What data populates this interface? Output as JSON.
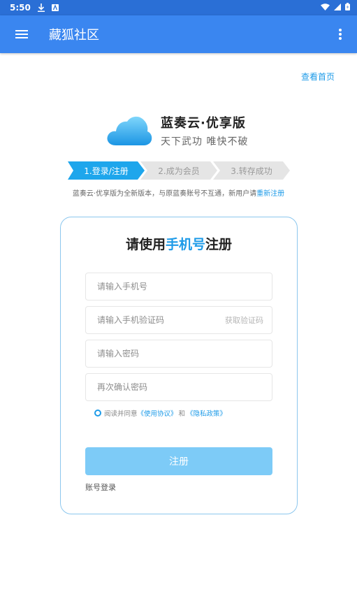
{
  "status_bar": {
    "time": "5:50"
  },
  "app_bar": {
    "title": "藏狐社区"
  },
  "header_link": "查看首页",
  "brand": {
    "name": "蓝奏云·优享版",
    "slogan": "天下武功 唯快不破"
  },
  "steps": [
    {
      "label": "1.登录/注册",
      "active": true
    },
    {
      "label": "2.成为会员",
      "active": false
    },
    {
      "label": "3.转存成功",
      "active": false
    }
  ],
  "notice": {
    "text": "蓝奏云·优享版为全新版本，与原蓝奏账号不互通，新用户请",
    "link": "重新注册"
  },
  "form": {
    "title_prefix": "请使用",
    "title_highlight": "手机号",
    "title_suffix": "注册",
    "phone_placeholder": "请输入手机号",
    "code_placeholder": "请输入手机验证码",
    "get_code": "获取验证码",
    "password_placeholder": "请输入密码",
    "confirm_placeholder": "再次确认密码",
    "agree_prefix": "阅读并同意",
    "terms_link": "《使用协议》",
    "agree_and": "和",
    "privacy_link": "《隐私政策》",
    "submit": "注册",
    "account_login": "账号登录"
  },
  "colors": {
    "primary": "#3a86f0",
    "accent": "#1e9be8",
    "button": "#7dcbf7"
  }
}
